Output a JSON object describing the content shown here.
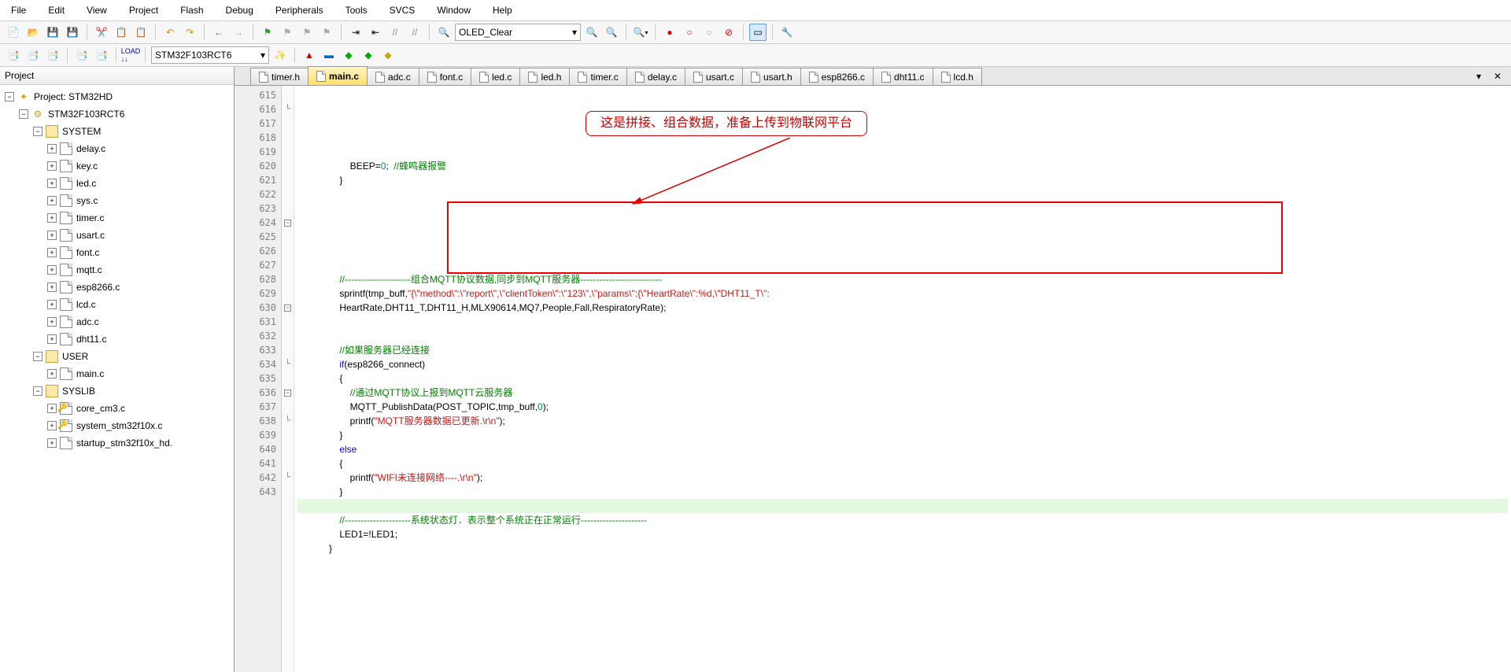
{
  "menu": [
    "File",
    "Edit",
    "View",
    "Project",
    "Flash",
    "Debug",
    "Peripherals",
    "Tools",
    "SVCS",
    "Window",
    "Help"
  ],
  "toolbar2_combo": "OLED_Clear",
  "toolbar3_combo": "STM32F103RCT6",
  "project": {
    "title": "Project",
    "root": "Project: STM32HD",
    "target": "STM32F103RCT6",
    "groups": [
      {
        "name": "SYSTEM",
        "open": true,
        "files": [
          "delay.c",
          "key.c",
          "led.c",
          "sys.c",
          "timer.c",
          "usart.c",
          "font.c",
          "mqtt.c",
          "esp8266.c",
          "lcd.c",
          "adc.c",
          "dht11.c"
        ]
      },
      {
        "name": "USER",
        "open": true,
        "files": [
          "main.c"
        ]
      },
      {
        "name": "SYSLIB",
        "open": true,
        "files": [
          "core_cm3.c",
          "system_stm32f10x.c",
          "startup_stm32f10x_hd."
        ]
      }
    ]
  },
  "tabs": {
    "list": [
      {
        "label": "timer.h",
        "active": false
      },
      {
        "label": "main.c",
        "active": true
      },
      {
        "label": "adc.c",
        "active": false
      },
      {
        "label": "font.c",
        "active": false
      },
      {
        "label": "led.c",
        "active": false
      },
      {
        "label": "led.h",
        "active": false
      },
      {
        "label": "timer.c",
        "active": false
      },
      {
        "label": "delay.c",
        "active": false
      },
      {
        "label": "usart.c",
        "active": false
      },
      {
        "label": "usart.h",
        "active": false
      },
      {
        "label": "esp8266.c",
        "active": false
      },
      {
        "label": "dht11.c",
        "active": false
      },
      {
        "label": "lcd.h",
        "active": false
      }
    ]
  },
  "callout": "这是拼接、组合数据，准备上传到物联网平台",
  "code": {
    "first_line": 615,
    "lines": [
      {
        "t": "                    BEEP=0; //蜂鸣器报警",
        "seg": [
          [
            "                    BEEP=",
            ""
          ],
          [
            "0",
            "num"
          ],
          [
            ";  ",
            ""
          ],
          [
            "//蜂鸣器报警",
            "cmt"
          ]
        ]
      },
      {
        "t": "                }",
        "seg": [
          [
            "                }",
            ""
          ]
        ],
        "fold": "end"
      },
      {
        "t": "",
        "seg": [
          [
            "",
            ""
          ]
        ]
      },
      {
        "t": "",
        "seg": [
          [
            "",
            ""
          ]
        ]
      },
      {
        "t": "",
        "seg": [
          [
            "",
            ""
          ]
        ]
      },
      {
        "t": "",
        "seg": [
          [
            "",
            ""
          ]
        ]
      },
      {
        "t": "",
        "seg": [
          [
            "",
            ""
          ]
        ]
      },
      {
        "t": "",
        "seg": [
          [
            "",
            ""
          ]
        ]
      },
      {
        "t": "                //---------------------组合MQTT协议数据,同步到MQTT服务器--------------------------",
        "seg": [
          [
            "                ",
            ""
          ],
          [
            "//---------------------组合MQTT协议数据,同步到MQTT服务器--------------------------",
            "cmt"
          ]
        ]
      },
      {
        "t": "                sprintf(tmp_buff,\"{\\\"method\\\":\\\"report\\\",\\\"clientToken\\\":\\\"123\\\",\\\"params\\\":{\\\"HeartRate\\\":%d,\\\"DHT11_T\\\":",
        "seg": [
          [
            "                sprintf(tmp_buff,",
            ""
          ],
          [
            "\"{\\\"method\\\":\\\"report\\\",\\\"clientToken\\\":\\\"123\\\",\\\"params\\\":{\\\"HeartRate\\\":%d,\\\"DHT11_T\\\":",
            "str"
          ]
        ],
        "fold": "open"
      },
      {
        "t": "                HeartRate,DHT11_T,DHT11_H,MLX90614,MQ7,People,Fall,RespiratoryRate);",
        "seg": [
          [
            "                HeartRate,DHT11_T,DHT11_H,MLX90614,MQ7,People,Fall,RespiratoryRate);",
            ""
          ]
        ]
      },
      {
        "t": "",
        "seg": [
          [
            "",
            ""
          ]
        ]
      },
      {
        "t": "",
        "seg": [
          [
            "",
            ""
          ]
        ]
      },
      {
        "t": "                //如果服务器已经连接",
        "seg": [
          [
            "                ",
            ""
          ],
          [
            "//如果服务器已经连接",
            "cmt"
          ]
        ]
      },
      {
        "t": "                if(esp8266_connect)",
        "seg": [
          [
            "                ",
            ""
          ],
          [
            "if",
            "kw"
          ],
          [
            "(esp8266_connect)",
            ""
          ]
        ]
      },
      {
        "t": "                {",
        "seg": [
          [
            "                {",
            ""
          ]
        ],
        "fold": "open"
      },
      {
        "t": "                    //通过MQTT协议上报到MQTT云服务器",
        "seg": [
          [
            "                    ",
            ""
          ],
          [
            "//通过MQTT协议上报到MQTT云服务器",
            "cmt"
          ]
        ]
      },
      {
        "t": "                    MQTT_PublishData(POST_TOPIC,tmp_buff,0);",
        "seg": [
          [
            "                    MQTT_PublishData(POST_TOPIC,tmp_buff,",
            ""
          ],
          [
            "0",
            "num"
          ],
          [
            ");",
            ""
          ]
        ]
      },
      {
        "t": "                    printf(\"MQTT服务器数据已更新.\\r\\n\");",
        "seg": [
          [
            "                    printf(",
            ""
          ],
          [
            "\"MQTT服务器数据已更新.\\r\\n\"",
            "str"
          ],
          [
            ");",
            ""
          ]
        ]
      },
      {
        "t": "                }",
        "seg": [
          [
            "                }",
            ""
          ]
        ],
        "fold": "end"
      },
      {
        "t": "                else",
        "seg": [
          [
            "                ",
            ""
          ],
          [
            "else",
            "kw"
          ]
        ]
      },
      {
        "t": "                {",
        "seg": [
          [
            "                {",
            ""
          ]
        ],
        "fold": "open"
      },
      {
        "t": "                    printf(\"WIFI未连接网络----.\\r\\n\");",
        "seg": [
          [
            "                    printf(",
            ""
          ],
          [
            "\"WIFI未连接网络----.\\r\\n\"",
            "str"
          ],
          [
            ");",
            ""
          ]
        ]
      },
      {
        "t": "                }",
        "seg": [
          [
            "                }",
            ""
          ]
        ],
        "fold": "end"
      },
      {
        "t": "",
        "seg": [
          [
            "",
            ""
          ]
        ],
        "hl": true
      },
      {
        "t": "                //---------------------系统状态灯．表示整个系统正在正常运行---------------------",
        "seg": [
          [
            "                ",
            ""
          ],
          [
            "//---------------------系统状态灯．表示整个系统正在正常运行---------------------",
            "cmt"
          ]
        ]
      },
      {
        "t": "                LED1=!LED1;",
        "seg": [
          [
            "                LED1=!LED1;",
            ""
          ]
        ]
      },
      {
        "t": "            }",
        "seg": [
          [
            "            }",
            ""
          ]
        ],
        "fold": "end"
      },
      {
        "t": "",
        "seg": [
          [
            "",
            ""
          ]
        ]
      }
    ]
  }
}
